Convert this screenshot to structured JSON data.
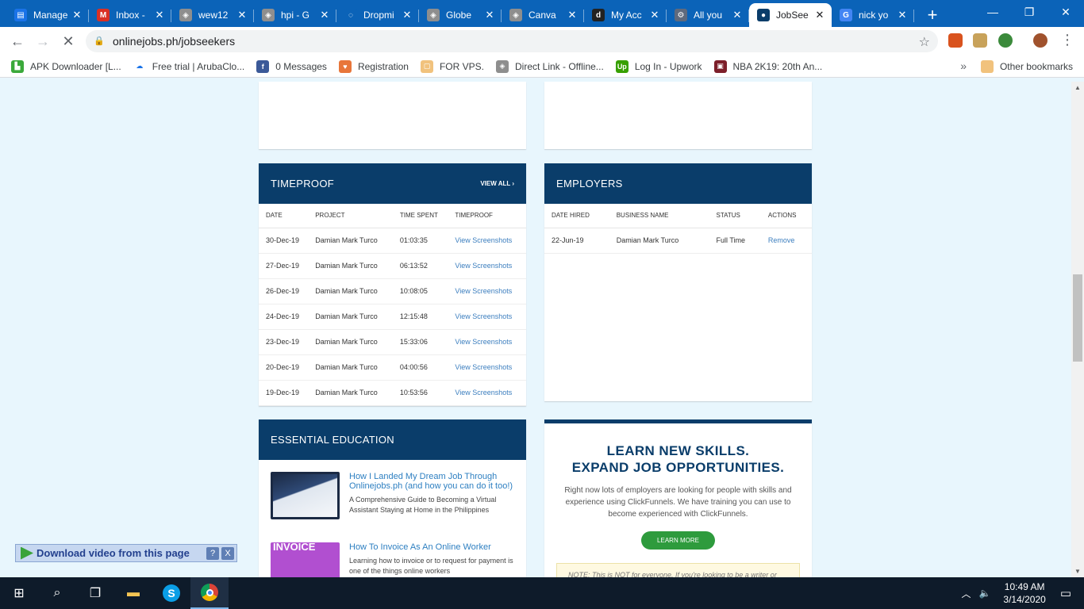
{
  "browser": {
    "tabs": [
      {
        "title": "Manage",
        "icon": "briefcase-icon",
        "color": "#1a73e8",
        "glyph": "▤"
      },
      {
        "title": "Inbox -",
        "icon": "gmail-icon",
        "color": "#d93025",
        "glyph": "M"
      },
      {
        "title": "wew12",
        "icon": "box-icon",
        "color": "#8e8e8e",
        "glyph": "◈"
      },
      {
        "title": "hpi - G",
        "icon": "box-icon",
        "color": "#8e8e8e",
        "glyph": "◈"
      },
      {
        "title": "Dropmi",
        "icon": "loading-icon",
        "color": "#0b63b8",
        "glyph": "◌"
      },
      {
        "title": "Globe",
        "icon": "box-icon",
        "color": "#8e8e8e",
        "glyph": "◈"
      },
      {
        "title": "Canva",
        "icon": "box-icon",
        "color": "#8e8e8e",
        "glyph": "◈"
      },
      {
        "title": "My Acc",
        "icon": "d-icon",
        "color": "#222222",
        "glyph": "d"
      },
      {
        "title": "All you",
        "icon": "gear-icon",
        "color": "#5f6a7d",
        "glyph": "⚙"
      },
      {
        "title": "JobSee",
        "icon": "location-icon",
        "color": "#0a3d6a",
        "glyph": "●"
      },
      {
        "title": "nick yo",
        "icon": "google-icon",
        "color": "#4285f4",
        "glyph": "G"
      }
    ],
    "url": "onlinejobs.ph/jobseekers",
    "bookmarks": [
      {
        "label": "APK Downloader [L...",
        "color": "#3ba93b",
        "glyph": "▙"
      },
      {
        "label": "Free trial | ArubaClo...",
        "color": "#ffffff",
        "glyph": "☁"
      },
      {
        "label": "0 Messages",
        "color": "#3b5998",
        "glyph": "f"
      },
      {
        "label": "Registration",
        "color": "#e8763a",
        "glyph": "♥"
      },
      {
        "label": "FOR VPS.",
        "color": "#f1c27d",
        "glyph": "▢"
      },
      {
        "label": "Direct Link - Offline...",
        "color": "#8e8e8e",
        "glyph": "◈"
      },
      {
        "label": "Log In - Upwork",
        "color": "#37a000",
        "glyph": "Up"
      },
      {
        "label": "NBA 2K19: 20th An...",
        "color": "#7d1f2a",
        "glyph": "▣"
      }
    ],
    "other_bookmarks": "Other bookmarks"
  },
  "timeproof": {
    "title": "TIMEPROOF",
    "view_all": "VIEW ALL",
    "headers": [
      "DATE",
      "PROJECT",
      "TIME SPENT",
      "TIMEPROOF"
    ],
    "rows": [
      [
        "30-Dec-19",
        "Damian Mark Turco",
        "01:03:35",
        "View Screenshots"
      ],
      [
        "27-Dec-19",
        "Damian Mark Turco",
        "06:13:52",
        "View Screenshots"
      ],
      [
        "26-Dec-19",
        "Damian Mark Turco",
        "10:08:05",
        "View Screenshots"
      ],
      [
        "24-Dec-19",
        "Damian Mark Turco",
        "12:15:48",
        "View Screenshots"
      ],
      [
        "23-Dec-19",
        "Damian Mark Turco",
        "15:33:06",
        "View Screenshots"
      ],
      [
        "20-Dec-19",
        "Damian Mark Turco",
        "04:00:56",
        "View Screenshots"
      ],
      [
        "19-Dec-19",
        "Damian Mark Turco",
        "10:53:56",
        "View Screenshots"
      ]
    ]
  },
  "employers": {
    "title": "EMPLOYERS",
    "headers": [
      "DATE HIRED",
      "BUSINESS NAME",
      "STATUS",
      "ACTIONS"
    ],
    "rows": [
      [
        "22-Jun-19",
        "Damian Mark Turco",
        "Full Time",
        "Remove"
      ]
    ]
  },
  "education": {
    "title": "ESSENTIAL EDUCATION",
    "items": [
      {
        "title": "How I Landed My Dream Job Through Onlinejobs.ph (and how you can do it too!)",
        "desc": "A Comprehensive Guide to Becoming a Virtual Assistant Staying at Home in the Philippines"
      },
      {
        "title": "How To Invoice As An Online Worker",
        "desc": "Learning how to invoice or to request for payment is one of the things online workers"
      }
    ],
    "thumb2_text": "INVOICE"
  },
  "promo": {
    "title_line1": "LEARN NEW SKILLS.",
    "title_line2": "EXPAND JOB OPPORTUNITIES.",
    "body": "Right now lots of employers are looking for people with skills and experience using ClickFunnels. We have training you can use to become experienced with ClickFunnels.",
    "button": "LEARN MORE",
    "note": "NOTE: This is NOT for everyone. If you're looking to be a writer or"
  },
  "download_bar": {
    "label": "Download video from this page",
    "help": "?",
    "close": "X"
  },
  "taskbar": {
    "time": "10:49 AM",
    "date": "3/14/2020"
  },
  "colors": {
    "header_navy": "#0a3d6a",
    "link_blue": "#3d7fbf",
    "button_green": "#2e9b3d",
    "page_bg": "#e8f6fd"
  }
}
